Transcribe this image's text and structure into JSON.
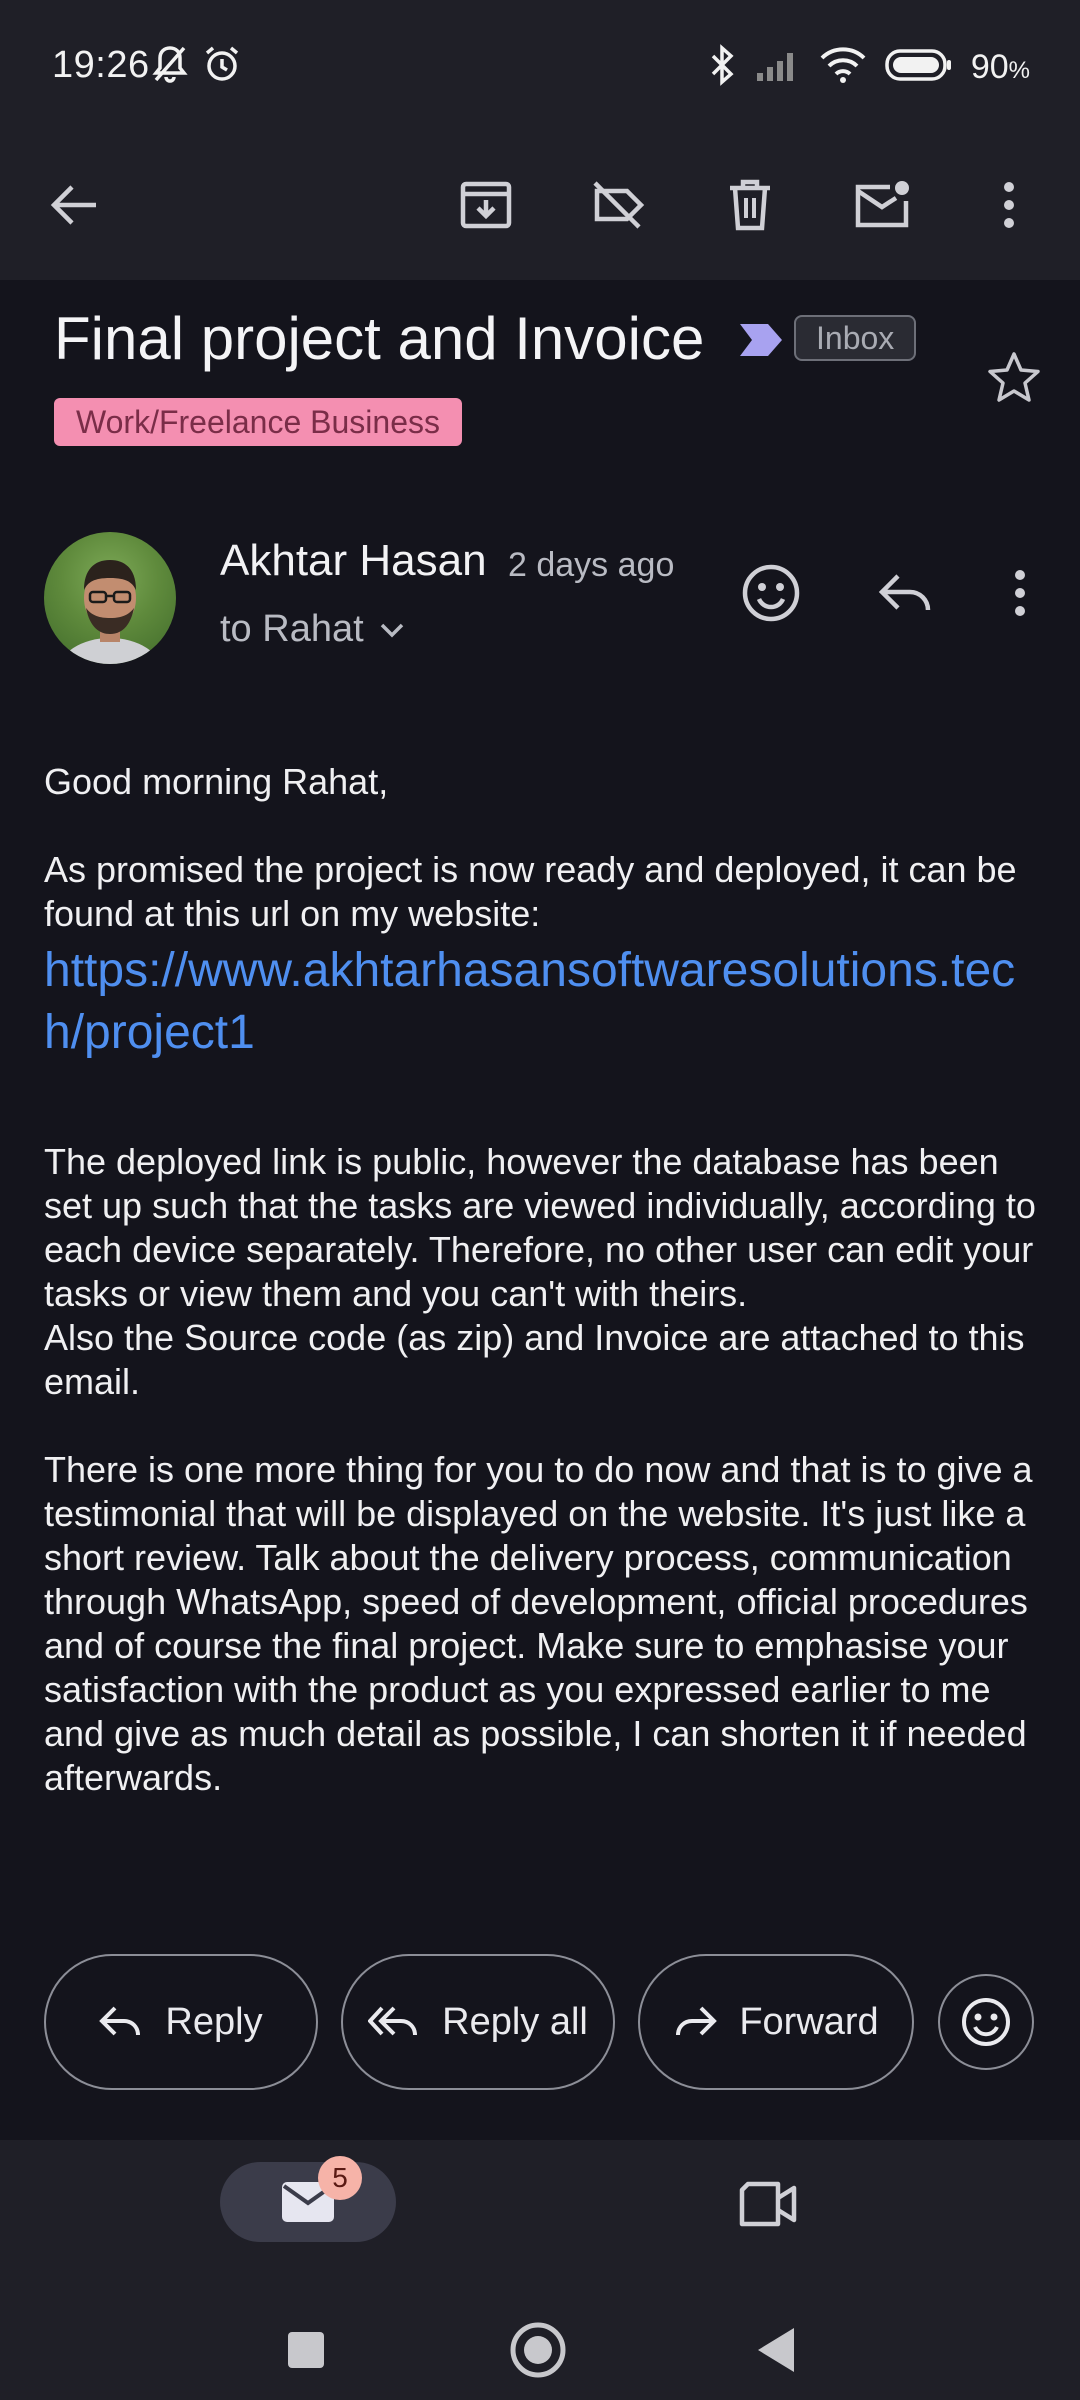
{
  "status_bar": {
    "time": "19:26",
    "battery": "90",
    "battery_unit": "%"
  },
  "toolbar": {
    "icons": [
      "back-arrow-icon",
      "archive-icon",
      "label-off-icon",
      "delete-icon",
      "mark-unread-icon",
      "more-vert-icon"
    ]
  },
  "email": {
    "subject": "Final project and Invoice",
    "folder_chip": "Inbox",
    "label_chip": "Work/Freelance Business",
    "label_color": "#f48fb1",
    "sender": {
      "name": "Akhtar Hasan",
      "time": "2 days ago",
      "recipient": "to Rahat"
    },
    "body": {
      "greeting": "Good morning Rahat,",
      "p1": "As promised the project is now ready and deployed, it can be found at this url on my website:",
      "link": "https://www.akhtarhasansoftwaresolutions.tech/project1",
      "p2a": "The deployed link is public, however the database has been set up such that the tasks are viewed individually, according to each device separately. Therefore, no other user can edit your tasks or view them and you can't with theirs.",
      "p2b": "Also the Source code (as zip) and Invoice are attached to this email.",
      "p3": "There is one more thing for you to do now and that is to give a testimonial that will be displayed on the website. It's just like a short review. Talk about the delivery process, communication through WhatsApp, speed of development, official procedures and of course the final project. Make sure to emphasise your satisfaction with the product as you expressed earlier to me and give as much detail as possible, I can shorten it if needed afterwards."
    }
  },
  "actions": {
    "reply": "Reply",
    "reply_all": "Reply all",
    "forward": "Forward"
  },
  "bottom_nav": {
    "mail_badge": "5"
  },
  "colors": {
    "background": "#14141c",
    "bar": "#1f1f27",
    "link": "#4f8ff0",
    "importance": "#a8a2f0"
  }
}
